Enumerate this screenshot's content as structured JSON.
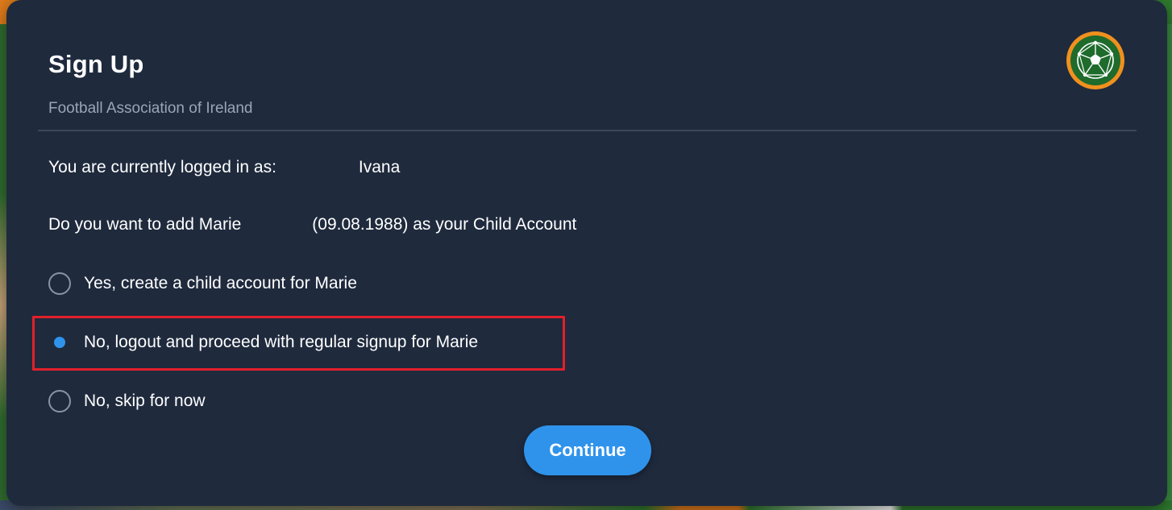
{
  "dialog": {
    "title": "Sign Up",
    "subtitle": "Football Association of Ireland",
    "logo_icon": "fai-football-logo-icon",
    "logged_in_label": "You are currently logged in as:",
    "logged_in_user": "Ivana",
    "question_prefix": "Do you want to add Marie",
    "question_suffix": "(09.08.1988) as your Child Account",
    "options": [
      {
        "label": "Yes, create a child account for Marie",
        "selected": false
      },
      {
        "label": "No, logout and proceed with regular signup for Marie",
        "selected": true
      },
      {
        "label": "No, skip for now",
        "selected": false
      }
    ],
    "continue_label": "Continue"
  },
  "colors": {
    "dialog_bg": "#1f2a3d",
    "accent": "#2f93ec",
    "subtitle": "#9aa5b8",
    "highlight": "#e3202b",
    "logo_green": "#1e6b2c",
    "logo_orange": "#f0901e"
  }
}
